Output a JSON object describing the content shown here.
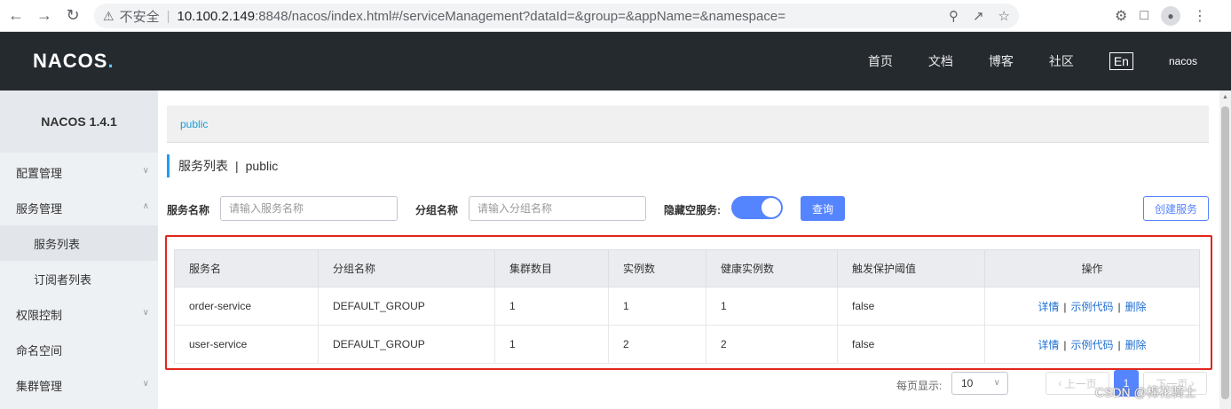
{
  "browser": {
    "insecure_label": "不安全",
    "url_host": "10.100.2.149",
    "url_path": ":8848/nacos/index.html#/serviceManagement?dataId=&group=&appName=&namespace="
  },
  "header": {
    "logo": "NACOS",
    "logo_dot": ".",
    "nav": [
      "首页",
      "文档",
      "博客",
      "社区"
    ],
    "lang": "En",
    "user": "nacos"
  },
  "sidebar": {
    "title": "NACOS 1.4.1",
    "items": {
      "config": "配置管理",
      "service": "服务管理",
      "service_list": "服务列表",
      "subscriber_list": "订阅者列表",
      "permission": "权限控制",
      "namespace": "命名空间",
      "cluster": "集群管理"
    }
  },
  "main": {
    "breadcrumb": "public",
    "title": "服务列表",
    "title_sep": "|",
    "title_ns": "public",
    "filter": {
      "service_name_label": "服务名称",
      "service_name_placeholder": "请输入服务名称",
      "group_name_label": "分组名称",
      "group_name_placeholder": "请输入分组名称",
      "hide_empty_label": "隐藏空服务:",
      "query_button": "查询",
      "create_button": "创建服务"
    },
    "table": {
      "headers": [
        "服务名",
        "分组名称",
        "集群数目",
        "实例数",
        "健康实例数",
        "触发保护阈值",
        "操作"
      ],
      "rows": [
        [
          "order-service",
          "DEFAULT_GROUP",
          "1",
          "1",
          "1",
          "false"
        ],
        [
          "user-service",
          "DEFAULT_GROUP",
          "1",
          "2",
          "2",
          "false"
        ]
      ],
      "actions": {
        "detail": "详情",
        "sample_code": "示例代码",
        "delete": "删除",
        "sep": "|"
      }
    },
    "pagination": {
      "page_size_label": "每页显示:",
      "page_size": "10",
      "prev": "上一页",
      "current": "1",
      "next": "下一页"
    }
  },
  "watermark": "CSDN @棉花骑士"
}
